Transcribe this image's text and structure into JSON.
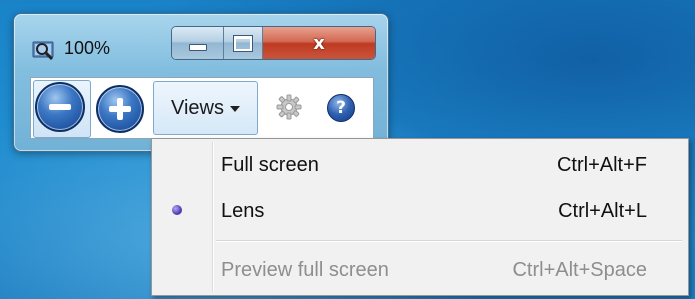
{
  "window": {
    "title_icon": "magnifier-icon",
    "zoom_level": "100%",
    "caption": {
      "minimize_icon": "minimize-icon",
      "maximize_icon": "maximize-icon",
      "close_glyph": "x"
    }
  },
  "toolbar": {
    "zoom_out_icon": "minus-icon",
    "zoom_in_icon": "plus-icon",
    "views_label": "Views",
    "options_icon": "gear-icon",
    "help_glyph": "?"
  },
  "menu": {
    "items": [
      {
        "label": "Full screen",
        "shortcut": "Ctrl+Alt+F",
        "selected": false,
        "enabled": true
      },
      {
        "label": "Lens",
        "shortcut": "Ctrl+Alt+L",
        "selected": true,
        "enabled": true
      },
      {
        "label": "Preview full screen",
        "shortcut": "Ctrl+Alt+Space",
        "selected": false,
        "enabled": false
      }
    ]
  },
  "colors": {
    "desktop": "#1b7dbf",
    "close_button": "#c9553b",
    "menu_background": "#f1f1f1",
    "disabled_text": "#8e8e8e"
  }
}
